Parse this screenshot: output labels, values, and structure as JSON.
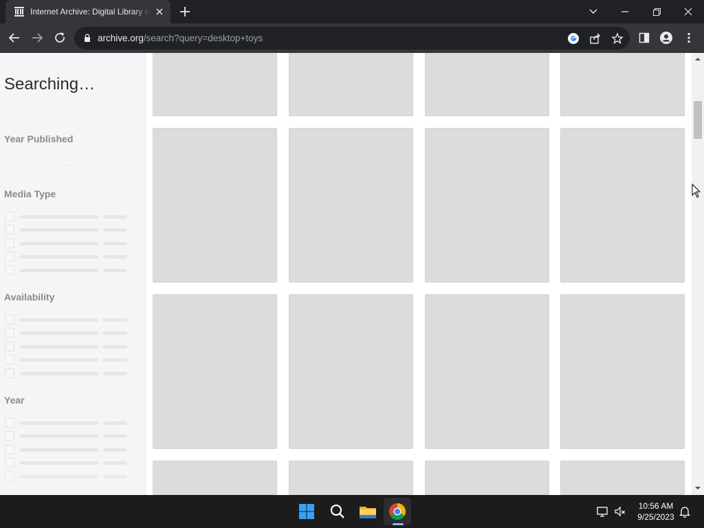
{
  "browser": {
    "tab_title": "Internet Archive: Digital Library of Free & Borrowable Books, Movies, Music & Wayback Machine",
    "url_host": "archive.org",
    "url_path": "/search?query=desktop+toys"
  },
  "sidebar": {
    "status": "Searching…",
    "facets": [
      {
        "title": "Year Published"
      },
      {
        "title": "Media Type"
      },
      {
        "title": "Availability"
      },
      {
        "title": "Year"
      }
    ],
    "loading_dots": "···"
  },
  "taskbar": {
    "time": "10:56 AM",
    "date": "9/25/2023"
  },
  "colors": {
    "chrome_dark": "#202124",
    "chrome_tab": "#35363a",
    "sidebar_bg": "#f5f5f7",
    "placeholder_card": "#dcdcdc"
  }
}
